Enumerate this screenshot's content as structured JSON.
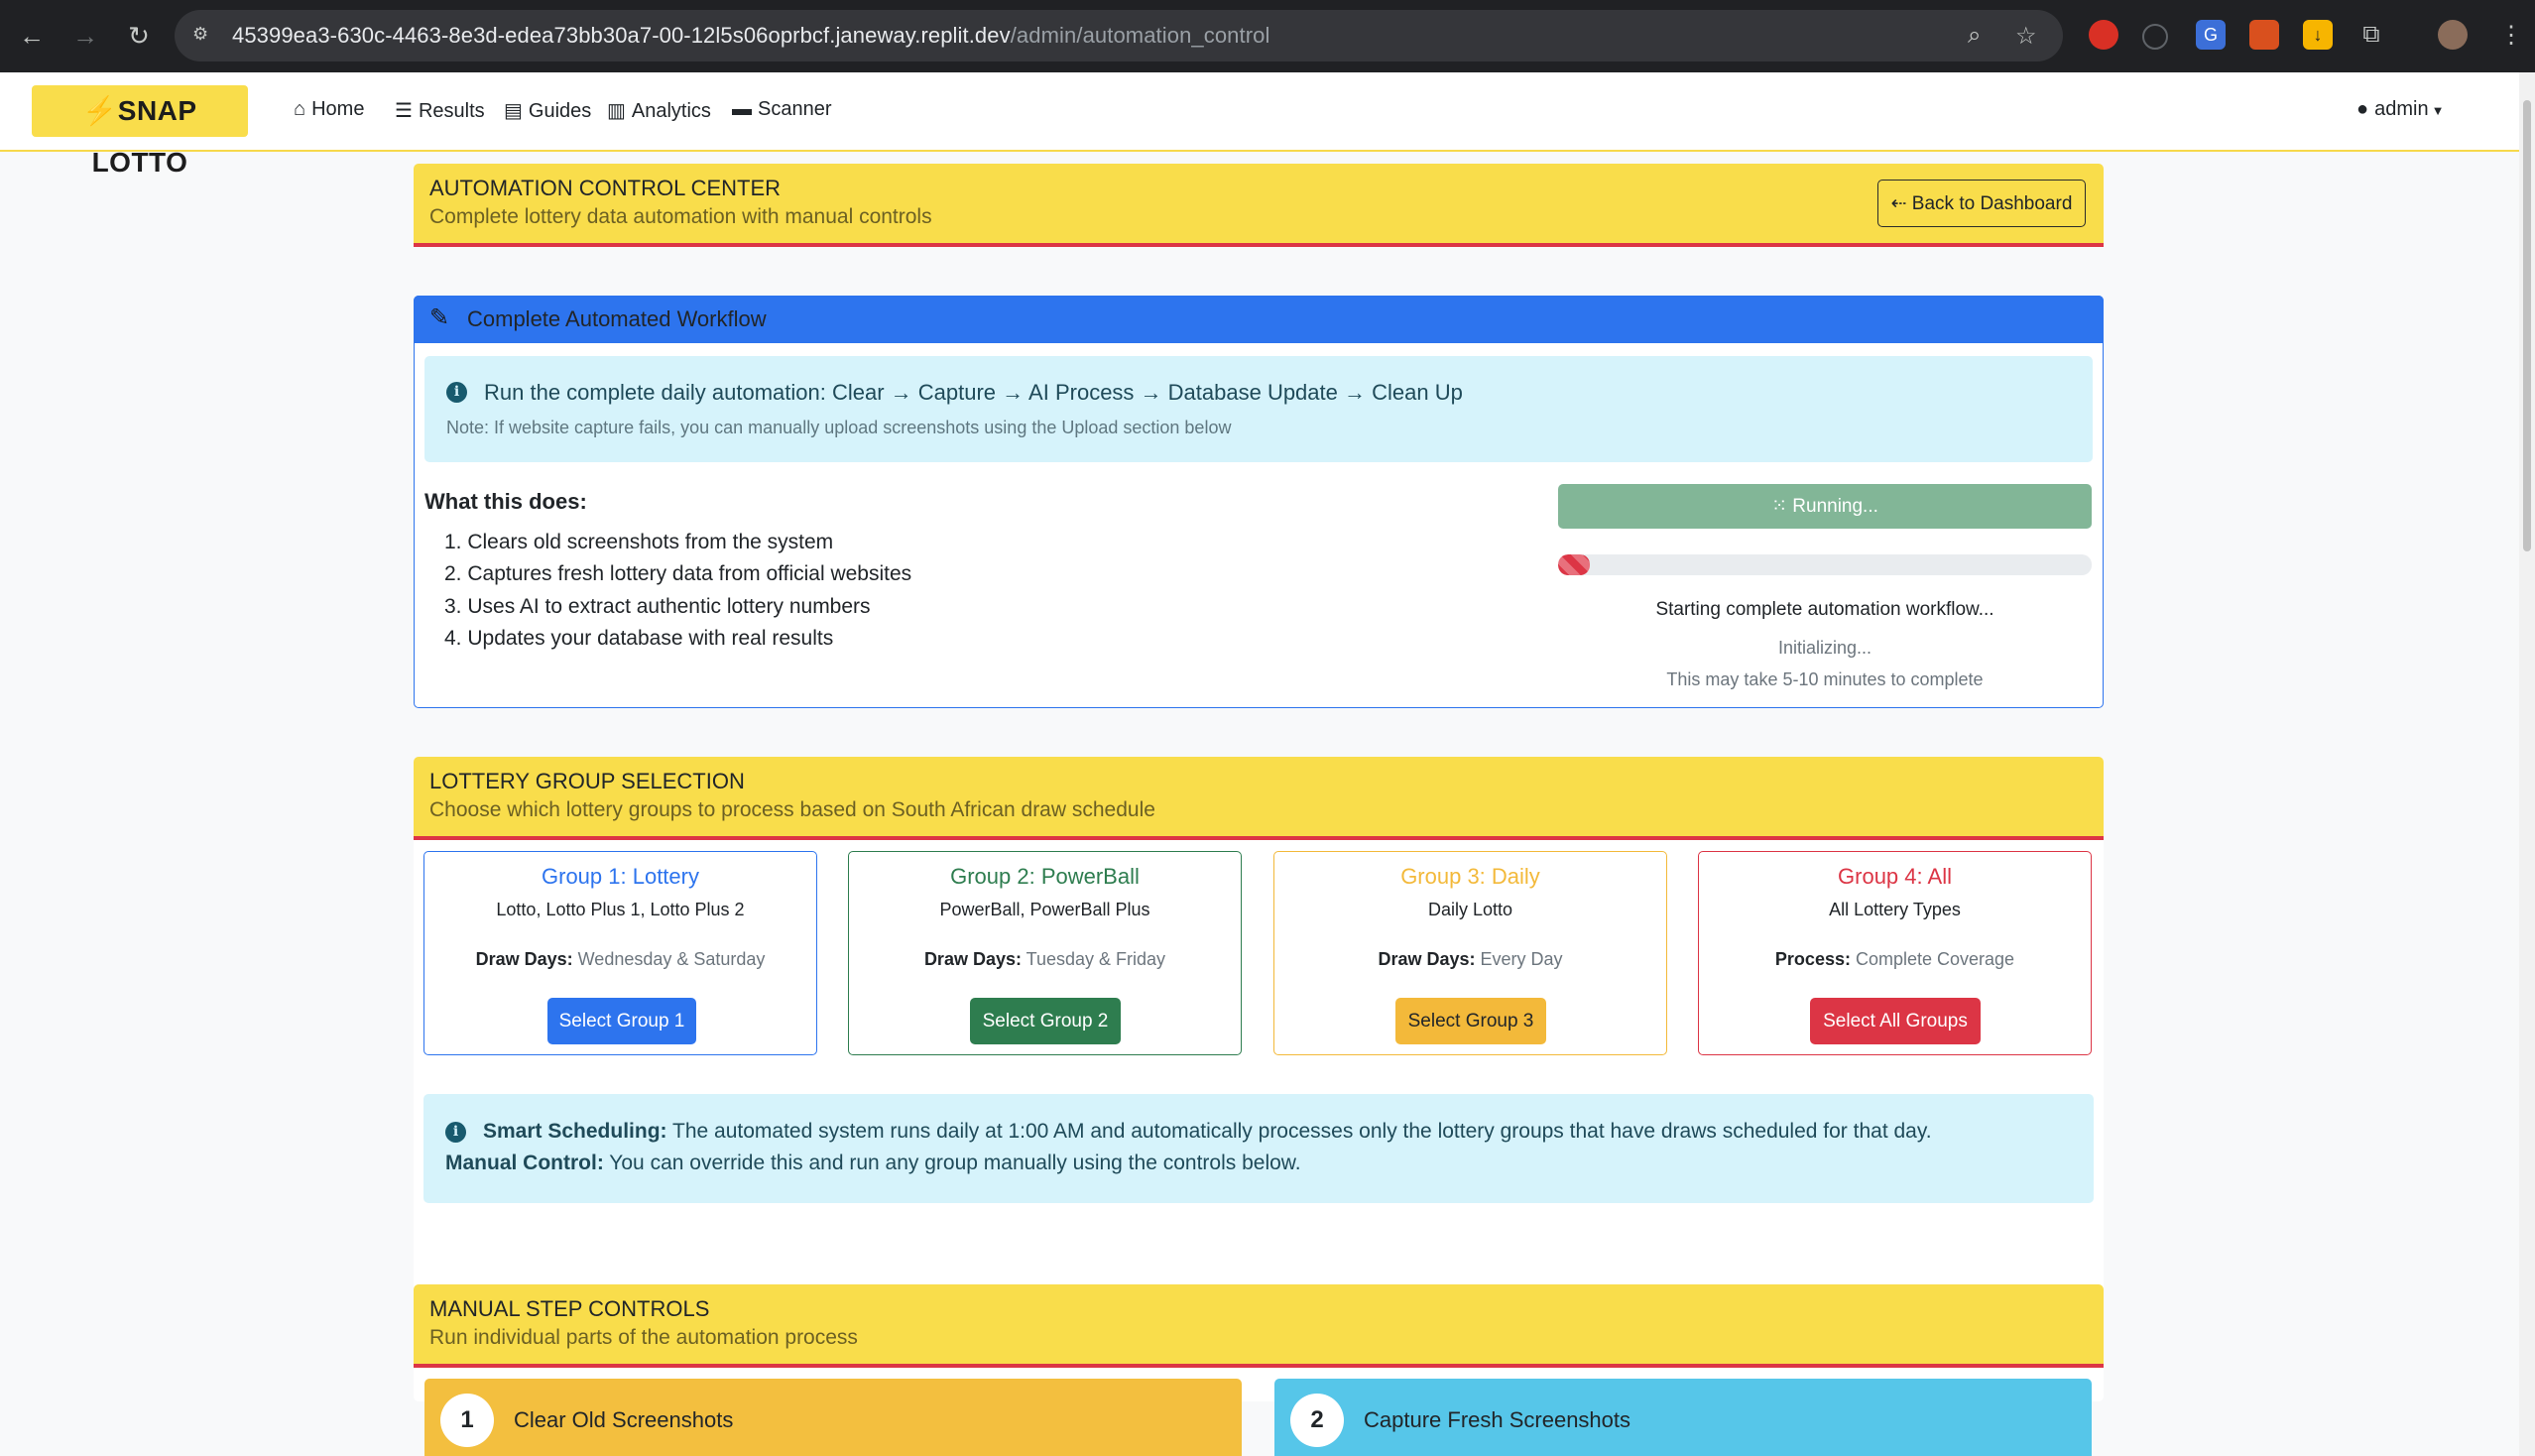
{
  "browser": {
    "url_main": "45399ea3-630c-4463-8e3d-edea73bb30a7-00-12l5s06oprbcf.janeway.replit.dev",
    "url_path": "/admin/automation_control"
  },
  "navbar": {
    "brand": "SNAP LOTTO",
    "links": [
      "Home",
      "Results",
      "Guides",
      "Analytics",
      "Scanner"
    ],
    "user": "admin"
  },
  "header": {
    "title": "AUTOMATION CONTROL CENTER",
    "subtitle": "Complete lottery data automation with manual controls",
    "back_label": "Back to Dashboard"
  },
  "workflow": {
    "title": "Complete Automated Workflow",
    "alert_main": "Run the complete daily automation: Clear → Capture → AI Process → Database Update → Clean Up",
    "alert_note": "Note: If website capture fails, you can manually upload screenshots using the Upload section below",
    "what_title": "What this does:",
    "steps": [
      "1. Clears old screenshots from the system",
      "2. Captures fresh lottery data from official websites",
      "3. Uses AI to extract authentic lottery numbers",
      "4. Updates your database with real results"
    ],
    "run_label": "Running...",
    "progress_fraction": 0.06,
    "status": "Starting complete automation workflow...",
    "sub_status": "Initializing...",
    "time_note": "This may take 5-10 minutes to complete"
  },
  "groups_section": {
    "title": "LOTTERY GROUP SELECTION",
    "subtitle": "Choose which lottery groups to process based on South African draw schedule",
    "groups": [
      {
        "title": "Group 1: Lottery",
        "games": "Lotto, Lotto Plus 1, Lotto Plus 2",
        "key": "Draw Days:",
        "value": "Wednesday & Saturday",
        "button": "Select Group 1",
        "color": "#2d74ee"
      },
      {
        "title": "Group 2: PowerBall",
        "games": "PowerBall, PowerBall Plus",
        "key": "Draw Days:",
        "value": "Tuesday & Friday",
        "button": "Select Group 2",
        "color": "#2e7d4f"
      },
      {
        "title": "Group 3: Daily",
        "games": "Daily Lotto",
        "key": "Draw Days:",
        "value": "Every Day",
        "button": "Select Group 3",
        "color": "#f3b93a"
      },
      {
        "title": "Group 4: All",
        "games": "All Lottery Types",
        "key": "Process:",
        "value": "Complete Coverage",
        "button": "Select All Groups",
        "color": "#dc3545"
      }
    ],
    "smart_label": "Smart Scheduling:",
    "smart_text": "The automated system runs daily at 1:00 AM and automatically processes only the lottery groups that have draws scheduled for that day.",
    "manual_label": "Manual Control:",
    "manual_text": "You can override this and run any group manually using the controls below."
  },
  "manual_section": {
    "title": "MANUAL STEP CONTROLS",
    "subtitle": "Run individual parts of the automation process",
    "steps": [
      {
        "num": "1",
        "label": "Clear Old Screenshots",
        "color": "#f3bf3f"
      },
      {
        "num": "2",
        "label": "Capture Fresh Screenshots",
        "color": "#56c6e9"
      }
    ]
  }
}
